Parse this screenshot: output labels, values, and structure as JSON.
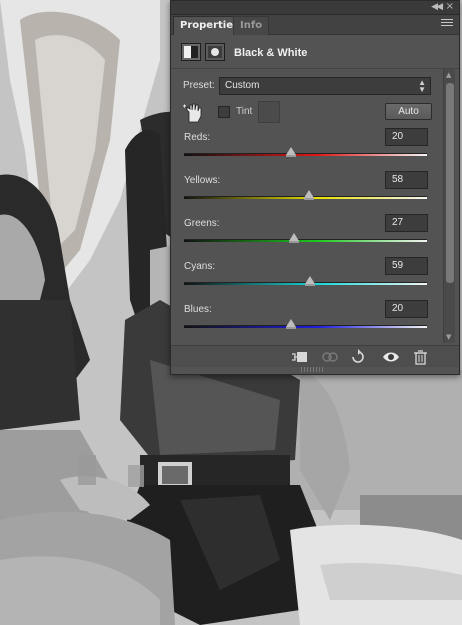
{
  "panel": {
    "tabs": [
      {
        "label": "Properties",
        "active": true
      },
      {
        "label": "Info",
        "active": false
      }
    ],
    "adjustment_title": "Black & White",
    "preset": {
      "label": "Preset:",
      "value": "Custom"
    },
    "tint": {
      "label": "Tint",
      "checked": false
    },
    "auto_label": "Auto",
    "sliders": [
      {
        "label": "Reds:",
        "value": "20",
        "color": "#e01818"
      },
      {
        "label": "Yellows:",
        "value": "58",
        "color": "#e8e000"
      },
      {
        "label": "Greens:",
        "value": "27",
        "color": "#1ec81e"
      },
      {
        "label": "Cyans:",
        "value": "59",
        "color": "#18d8d8"
      },
      {
        "label": "Blues:",
        "value": "20",
        "color": "#1e1ee0"
      }
    ],
    "icons": {
      "collapse": "collapse-icon",
      "close": "close-icon",
      "menu": "panel-menu-icon",
      "hand": "targeted-adjustment-hand-icon",
      "clip": "clip-to-layer-icon",
      "view_previous": "view-previous-state-icon",
      "reset": "reset-icon",
      "visibility": "eye-icon",
      "delete": "trash-icon"
    }
  }
}
